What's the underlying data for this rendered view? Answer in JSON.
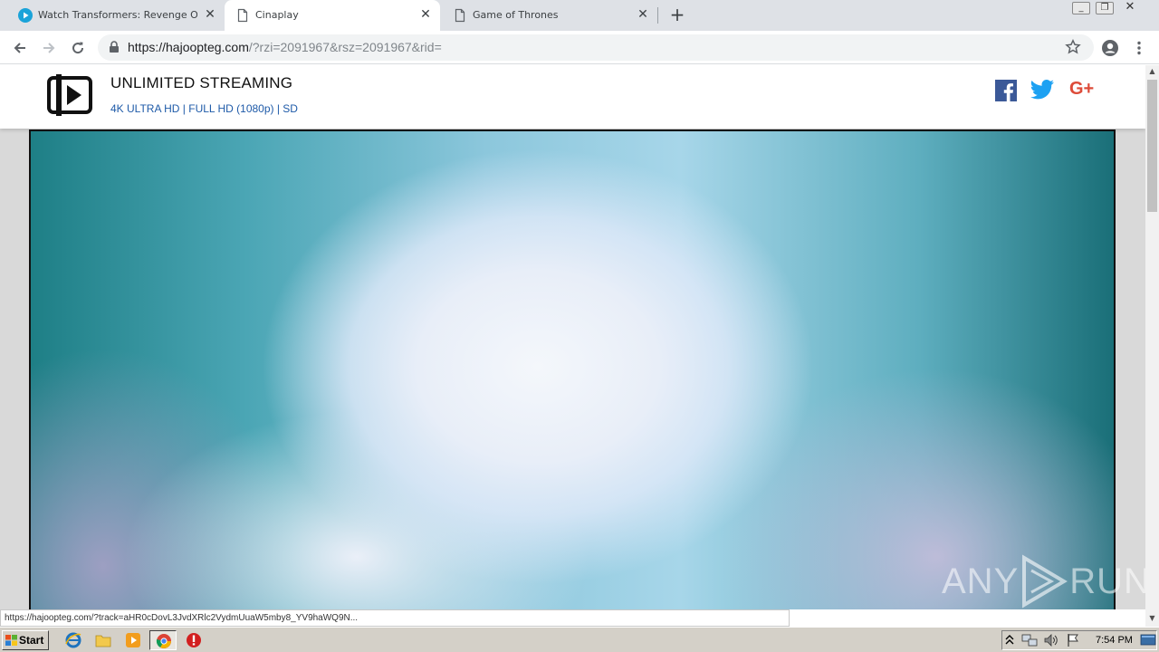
{
  "browser": {
    "tabs": [
      {
        "title": "Watch Transformers: Revenge Of Th",
        "icon": "play-circle-icon",
        "active": false
      },
      {
        "title": "Cinaplay",
        "icon": "document-icon",
        "active": true
      },
      {
        "title": "Game of Thrones",
        "icon": "document-icon",
        "active": false
      }
    ],
    "url_host": "https://hajoopteg.com",
    "url_rest": "/?rzi=2091967&rsz=2091967&rid=",
    "status_url": "https://hajoopteg.com/?track=aHR0cDovL3JvdXRlc2VydmUuaW5mby8_YV9haWQ9N..."
  },
  "site": {
    "brand": "UNLIMITED STREAMING",
    "quality_links": "4K ULTRA HD | FULL HD (1080p) | SD",
    "social": [
      "facebook-icon",
      "twitter-icon",
      "google-plus-icon"
    ],
    "google_plus_label": "G+"
  },
  "watermark": {
    "left": "ANY",
    "right": "RUN"
  },
  "taskbar": {
    "start_label": "Start",
    "clock": "7:54 PM"
  },
  "colors": {
    "accent_link": "#1e5aa8",
    "facebook": "#3b5998",
    "twitter": "#1da1f2",
    "google_plus": "#dd4b39"
  }
}
